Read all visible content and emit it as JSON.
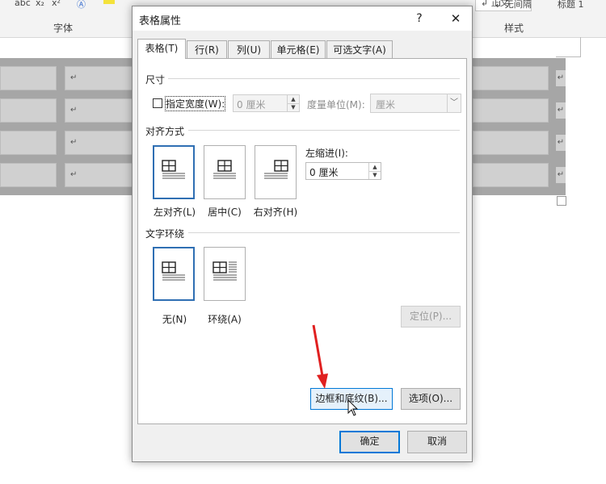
{
  "ribbon": {
    "font_group": "字体",
    "styles_group": "样式",
    "style_no_spacing": "↲ 无间隔",
    "style_heading1": "标题 1",
    "style_normal": "↲ 正文",
    "strikethrough": "abc",
    "subscript": "x₂",
    "superscript": "x²"
  },
  "doc": {
    "cell_mark": "↵"
  },
  "dialog": {
    "title": "表格属性",
    "help": "?",
    "close": "✕",
    "tabs": [
      {
        "label": "表格(T)"
      },
      {
        "label": "行(R)"
      },
      {
        "label": "列(U)"
      },
      {
        "label": "单元格(E)"
      },
      {
        "label": "可选文字(A)"
      }
    ],
    "size": {
      "section": "尺寸",
      "specify_width": "指定宽度(W):",
      "width_value": "0 厘米",
      "unit_label": "度量单位(M):",
      "unit_value": "厘米"
    },
    "alignment": {
      "section": "对齐方式",
      "left": "左对齐(L)",
      "center": "居中(C)",
      "right": "右对齐(H)",
      "indent_label": "左缩进(I):",
      "indent_value": "0 厘米"
    },
    "wrapping": {
      "section": "文字环绕",
      "none": "无(N)",
      "around": "环绕(A)",
      "positioning": "定位(P)..."
    },
    "borders_button": "边框和底纹(B)...",
    "options_button": "选项(O)...",
    "ok": "确定",
    "cancel": "取消"
  },
  "colors": {
    "accent": "#0078d7",
    "selected_border": "#2f6fb3",
    "arrow": "#e02020"
  }
}
